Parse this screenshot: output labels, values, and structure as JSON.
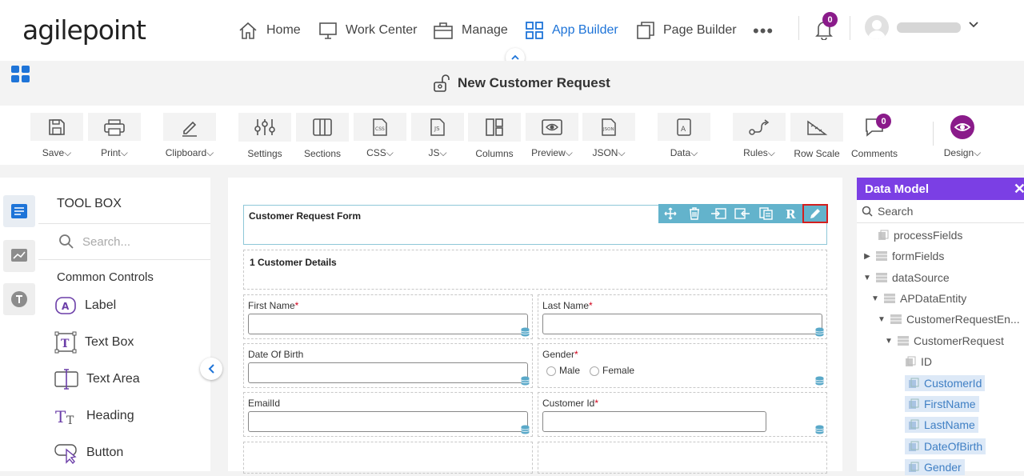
{
  "brand": {
    "logo_text": "agilepoint"
  },
  "nav": {
    "home": "Home",
    "work_center": "Work Center",
    "manage": "Manage",
    "app_builder": "App Builder",
    "page_builder": "Page Builder",
    "more": "•••",
    "notifications_count": "0",
    "user_name": "████████",
    "active_color": "#1e74d8"
  },
  "page": {
    "title": "New Customer Request"
  },
  "ribbon": {
    "save": "Save",
    "print": "Print",
    "clipboard": "Clipboard",
    "settings": "Settings",
    "sections": "Sections",
    "css": "CSS",
    "js": "JS",
    "columns": "Columns",
    "preview": "Preview",
    "json": "JSON",
    "data": "Data",
    "rules": "Rules",
    "row_scale": "Row Scale",
    "comments": "Comments",
    "comments_count": "0",
    "design": "Design",
    "design_color": "#8a1b8a"
  },
  "toolbox": {
    "title": "TOOL BOX",
    "search_placeholder": "Search...",
    "section": "Common Controls",
    "items": [
      "Label",
      "Text Box",
      "Text Area",
      "Heading",
      "Button"
    ]
  },
  "form": {
    "header": "Customer Request Form",
    "section": "1 Customer Details",
    "fields": {
      "first_name": "First Name",
      "last_name": "Last Name",
      "dob": "Date Of Birth",
      "gender": "Gender",
      "gender_options": [
        "Male",
        "Female"
      ],
      "email": "EmailId",
      "customer_id": "Customer Id"
    },
    "required_mark": "*",
    "toolbar_color": "#63b3cc",
    "selected_outline_color": "#d31f1f"
  },
  "data_model": {
    "title": "Data Model",
    "search_placeholder": "Search",
    "header_color": "#7b3fe4",
    "tree": [
      "processFields",
      "formFields",
      "dataSource",
      "APDataEntity",
      "CustomerRequestEn...",
      "CustomerRequest",
      "ID",
      "CustomerId",
      "FirstName",
      "LastName",
      "DateOfBirth",
      "Gender"
    ]
  }
}
